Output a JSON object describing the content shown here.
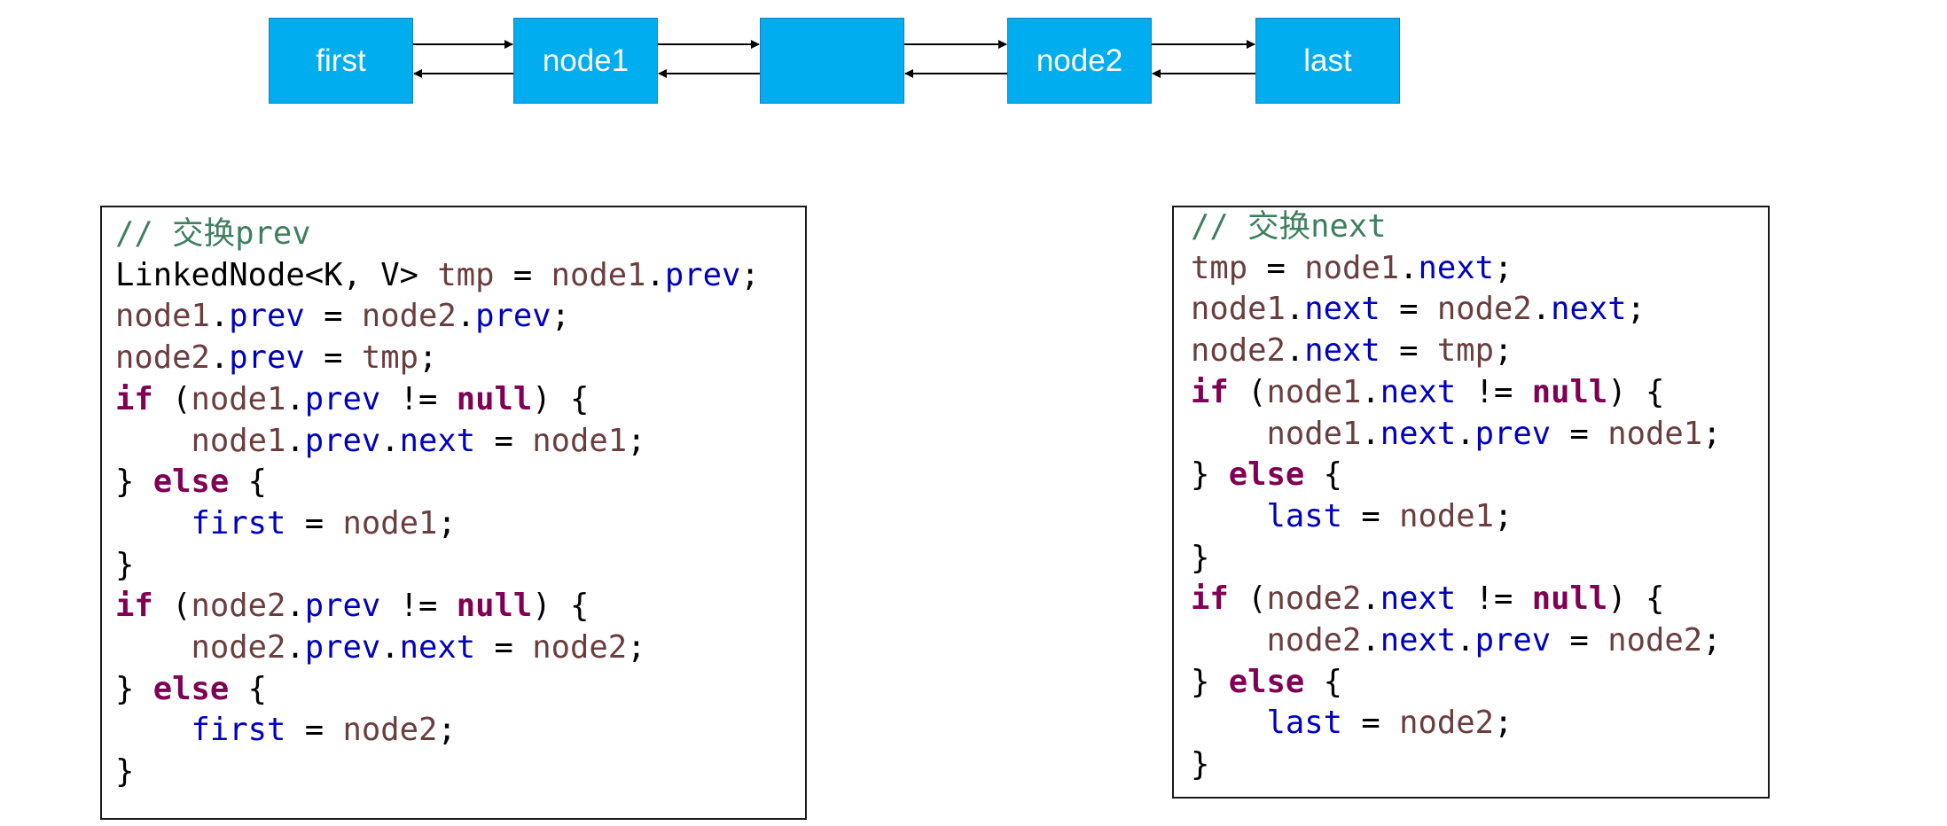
{
  "nodes": [
    {
      "label": "first"
    },
    {
      "label": "node1"
    },
    {
      "label": ""
    },
    {
      "label": "node2"
    },
    {
      "label": "last"
    }
  ],
  "colors": {
    "node_fill": "#00adef",
    "comment": "#3f7f5f",
    "keyword": "#7f0055",
    "field": "#0000c0",
    "local_var": "#6a3e3e"
  },
  "code_prev": {
    "lines": [
      [
        {
          "t": "// ",
          "c": "cm"
        },
        {
          "t": "交换",
          "c": "cmz"
        },
        {
          "t": "prev",
          "c": "cm"
        }
      ],
      [
        {
          "t": "LinkedNode<K, V> ",
          "c": "pl"
        },
        {
          "t": "tmp",
          "c": "var"
        },
        {
          "t": " = ",
          "c": "pl"
        },
        {
          "t": "node1",
          "c": "var"
        },
        {
          "t": ".",
          "c": "pl"
        },
        {
          "t": "prev",
          "c": "fld"
        },
        {
          "t": ";",
          "c": "pl"
        }
      ],
      [
        {
          "t": "node1",
          "c": "var"
        },
        {
          "t": ".",
          "c": "pl"
        },
        {
          "t": "prev",
          "c": "fld"
        },
        {
          "t": " = ",
          "c": "pl"
        },
        {
          "t": "node2",
          "c": "var"
        },
        {
          "t": ".",
          "c": "pl"
        },
        {
          "t": "prev",
          "c": "fld"
        },
        {
          "t": ";",
          "c": "pl"
        }
      ],
      [
        {
          "t": "node2",
          "c": "var"
        },
        {
          "t": ".",
          "c": "pl"
        },
        {
          "t": "prev",
          "c": "fld"
        },
        {
          "t": " = ",
          "c": "pl"
        },
        {
          "t": "tmp",
          "c": "var"
        },
        {
          "t": ";",
          "c": "pl"
        }
      ],
      [
        {
          "t": "if",
          "c": "kw"
        },
        {
          "t": " (",
          "c": "pl"
        },
        {
          "t": "node1",
          "c": "var"
        },
        {
          "t": ".",
          "c": "pl"
        },
        {
          "t": "prev",
          "c": "fld"
        },
        {
          "t": " != ",
          "c": "pl"
        },
        {
          "t": "null",
          "c": "kw"
        },
        {
          "t": ") {",
          "c": "pl"
        }
      ],
      [
        {
          "t": "    ",
          "c": "pl"
        },
        {
          "t": "node1",
          "c": "var"
        },
        {
          "t": ".",
          "c": "pl"
        },
        {
          "t": "prev",
          "c": "fld"
        },
        {
          "t": ".",
          "c": "pl"
        },
        {
          "t": "next",
          "c": "fld"
        },
        {
          "t": " = ",
          "c": "pl"
        },
        {
          "t": "node1",
          "c": "var"
        },
        {
          "t": ";",
          "c": "pl"
        }
      ],
      [
        {
          "t": "} ",
          "c": "pl"
        },
        {
          "t": "else",
          "c": "kw"
        },
        {
          "t": " {",
          "c": "pl"
        }
      ],
      [
        {
          "t": "    ",
          "c": "pl"
        },
        {
          "t": "first",
          "c": "fld"
        },
        {
          "t": " = ",
          "c": "pl"
        },
        {
          "t": "node1",
          "c": "var"
        },
        {
          "t": ";",
          "c": "pl"
        }
      ],
      [
        {
          "t": "}",
          "c": "pl"
        }
      ],
      [
        {
          "t": "if",
          "c": "kw"
        },
        {
          "t": " (",
          "c": "pl"
        },
        {
          "t": "node2",
          "c": "var"
        },
        {
          "t": ".",
          "c": "pl"
        },
        {
          "t": "prev",
          "c": "fld"
        },
        {
          "t": " != ",
          "c": "pl"
        },
        {
          "t": "null",
          "c": "kw"
        },
        {
          "t": ") {",
          "c": "pl"
        }
      ],
      [
        {
          "t": "    ",
          "c": "pl"
        },
        {
          "t": "node2",
          "c": "var"
        },
        {
          "t": ".",
          "c": "pl"
        },
        {
          "t": "prev",
          "c": "fld"
        },
        {
          "t": ".",
          "c": "pl"
        },
        {
          "t": "next",
          "c": "fld"
        },
        {
          "t": " = ",
          "c": "pl"
        },
        {
          "t": "node2",
          "c": "var"
        },
        {
          "t": ";",
          "c": "pl"
        }
      ],
      [
        {
          "t": "} ",
          "c": "pl"
        },
        {
          "t": "else",
          "c": "kw"
        },
        {
          "t": " {",
          "c": "pl"
        }
      ],
      [
        {
          "t": "    ",
          "c": "pl"
        },
        {
          "t": "first",
          "c": "fld"
        },
        {
          "t": " = ",
          "c": "pl"
        },
        {
          "t": "node2",
          "c": "var"
        },
        {
          "t": ";",
          "c": "pl"
        }
      ],
      [
        {
          "t": "}",
          "c": "pl"
        }
      ]
    ]
  },
  "code_next": {
    "lines": [
      [
        {
          "t": "// ",
          "c": "cm"
        },
        {
          "t": "交换",
          "c": "cmz"
        },
        {
          "t": "next",
          "c": "cm"
        }
      ],
      [
        {
          "t": "tmp",
          "c": "var"
        },
        {
          "t": " = ",
          "c": "pl"
        },
        {
          "t": "node1",
          "c": "var"
        },
        {
          "t": ".",
          "c": "pl"
        },
        {
          "t": "next",
          "c": "fld"
        },
        {
          "t": ";",
          "c": "pl"
        }
      ],
      [
        {
          "t": "node1",
          "c": "var"
        },
        {
          "t": ".",
          "c": "pl"
        },
        {
          "t": "next",
          "c": "fld"
        },
        {
          "t": " = ",
          "c": "pl"
        },
        {
          "t": "node2",
          "c": "var"
        },
        {
          "t": ".",
          "c": "pl"
        },
        {
          "t": "next",
          "c": "fld"
        },
        {
          "t": ";",
          "c": "pl"
        }
      ],
      [
        {
          "t": "node2",
          "c": "var"
        },
        {
          "t": ".",
          "c": "pl"
        },
        {
          "t": "next",
          "c": "fld"
        },
        {
          "t": " = ",
          "c": "pl"
        },
        {
          "t": "tmp",
          "c": "var"
        },
        {
          "t": ";",
          "c": "pl"
        }
      ],
      [
        {
          "t": "if",
          "c": "kw"
        },
        {
          "t": " (",
          "c": "pl"
        },
        {
          "t": "node1",
          "c": "var"
        },
        {
          "t": ".",
          "c": "pl"
        },
        {
          "t": "next",
          "c": "fld"
        },
        {
          "t": " != ",
          "c": "pl"
        },
        {
          "t": "null",
          "c": "kw"
        },
        {
          "t": ") {",
          "c": "pl"
        }
      ],
      [
        {
          "t": "    ",
          "c": "pl"
        },
        {
          "t": "node1",
          "c": "var"
        },
        {
          "t": ".",
          "c": "pl"
        },
        {
          "t": "next",
          "c": "fld"
        },
        {
          "t": ".",
          "c": "pl"
        },
        {
          "t": "prev",
          "c": "fld"
        },
        {
          "t": " = ",
          "c": "pl"
        },
        {
          "t": "node1",
          "c": "var"
        },
        {
          "t": ";",
          "c": "pl"
        }
      ],
      [
        {
          "t": "} ",
          "c": "pl"
        },
        {
          "t": "else",
          "c": "kw"
        },
        {
          "t": " {",
          "c": "pl"
        }
      ],
      [
        {
          "t": "    ",
          "c": "pl"
        },
        {
          "t": "last",
          "c": "fld"
        },
        {
          "t": " = ",
          "c": "pl"
        },
        {
          "t": "node1",
          "c": "var"
        },
        {
          "t": ";",
          "c": "pl"
        }
      ],
      [
        {
          "t": "}",
          "c": "pl"
        }
      ],
      [
        {
          "t": "if",
          "c": "kw"
        },
        {
          "t": " (",
          "c": "pl"
        },
        {
          "t": "node2",
          "c": "var"
        },
        {
          "t": ".",
          "c": "pl"
        },
        {
          "t": "next",
          "c": "fld"
        },
        {
          "t": " != ",
          "c": "pl"
        },
        {
          "t": "null",
          "c": "kw"
        },
        {
          "t": ") {",
          "c": "pl"
        }
      ],
      [
        {
          "t": "    ",
          "c": "pl"
        },
        {
          "t": "node2",
          "c": "var"
        },
        {
          "t": ".",
          "c": "pl"
        },
        {
          "t": "next",
          "c": "fld"
        },
        {
          "t": ".",
          "c": "pl"
        },
        {
          "t": "prev",
          "c": "fld"
        },
        {
          "t": " = ",
          "c": "pl"
        },
        {
          "t": "node2",
          "c": "var"
        },
        {
          "t": ";",
          "c": "pl"
        }
      ],
      [
        {
          "t": "} ",
          "c": "pl"
        },
        {
          "t": "else",
          "c": "kw"
        },
        {
          "t": " {",
          "c": "pl"
        }
      ],
      [
        {
          "t": "    ",
          "c": "pl"
        },
        {
          "t": "last",
          "c": "fld"
        },
        {
          "t": " = ",
          "c": "pl"
        },
        {
          "t": "node2",
          "c": "var"
        },
        {
          "t": ";",
          "c": "pl"
        }
      ],
      [
        {
          "t": "}",
          "c": "pl"
        }
      ]
    ]
  }
}
